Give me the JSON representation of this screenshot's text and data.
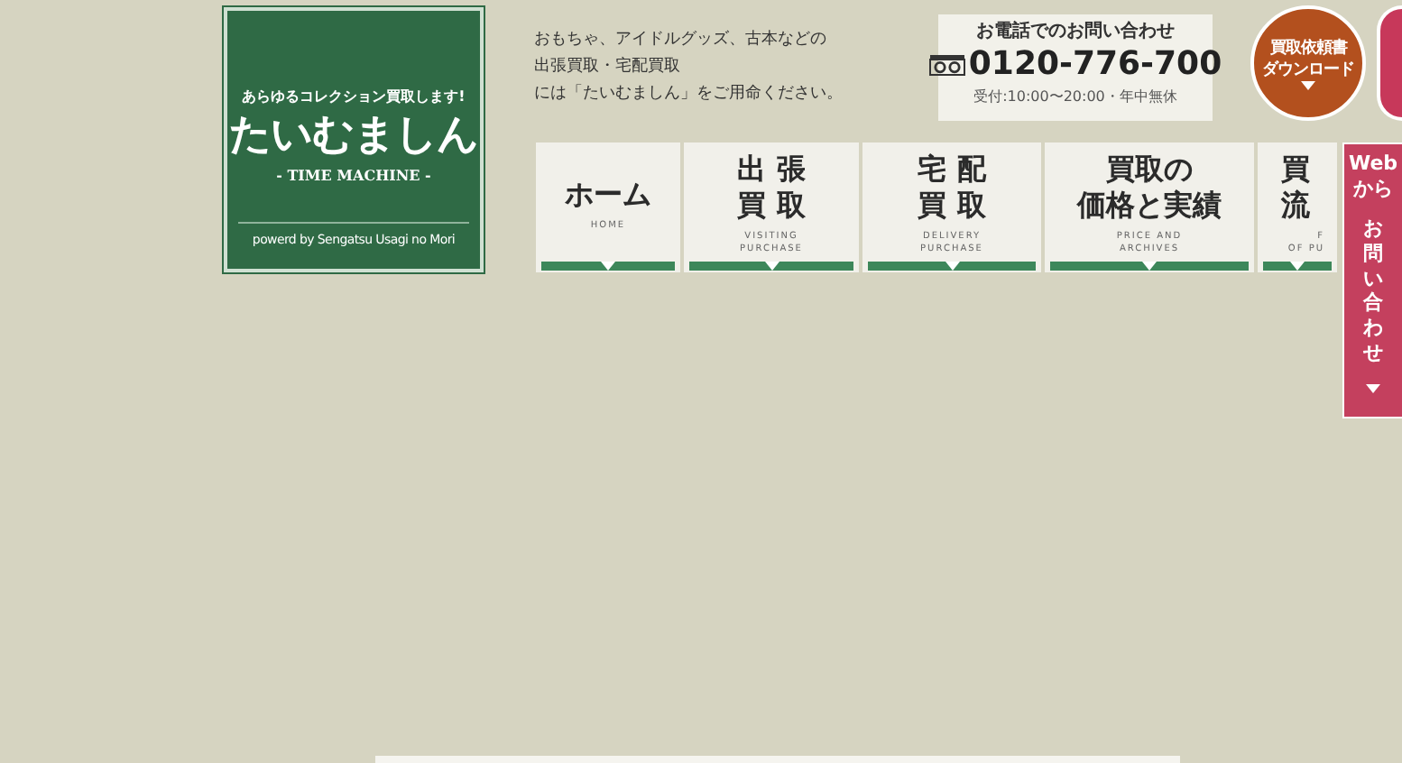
{
  "logo": {
    "tagline": "あらゆるコレクション買取します!",
    "name": "たいむましん",
    "subtitle": "- TIME MACHINE -",
    "credit": "powerd by Sengatsu Usagi no Mori"
  },
  "intro": [
    "おもちゃ、アイドルグッズ、古本などの",
    "出張買取・宅配買取",
    "には「たいむましん」をご用命ください。"
  ],
  "phone": {
    "heading": "お電話でのお問い合わせ",
    "number": "0120-776-700",
    "hours": "受付:10:00〜20:00・年中無休"
  },
  "download_button": {
    "lines": [
      "買取依頼書",
      "ダウンロード"
    ]
  },
  "nav": [
    {
      "title_lines": [
        "ホーム"
      ],
      "subtitle_lines": [
        "HOME"
      ]
    },
    {
      "title_lines": [
        "出 張",
        "買 取"
      ],
      "subtitle_lines": [
        "VISITING",
        "PURCHASE"
      ]
    },
    {
      "title_lines": [
        "宅 配",
        "買 取"
      ],
      "subtitle_lines": [
        "DELIVERY",
        "PURCHASE"
      ]
    },
    {
      "title_lines": [
        "買取の",
        "価格と実績"
      ],
      "subtitle_lines": [
        "PRICE AND",
        "ARCHIVES"
      ]
    },
    {
      "title_lines": [
        "買",
        "流"
      ],
      "subtitle_lines": [
        "F",
        "OF PU"
      ]
    }
  ],
  "side_tab": {
    "lines": [
      "Web",
      "から",
      "お問い合わせ"
    ]
  }
}
